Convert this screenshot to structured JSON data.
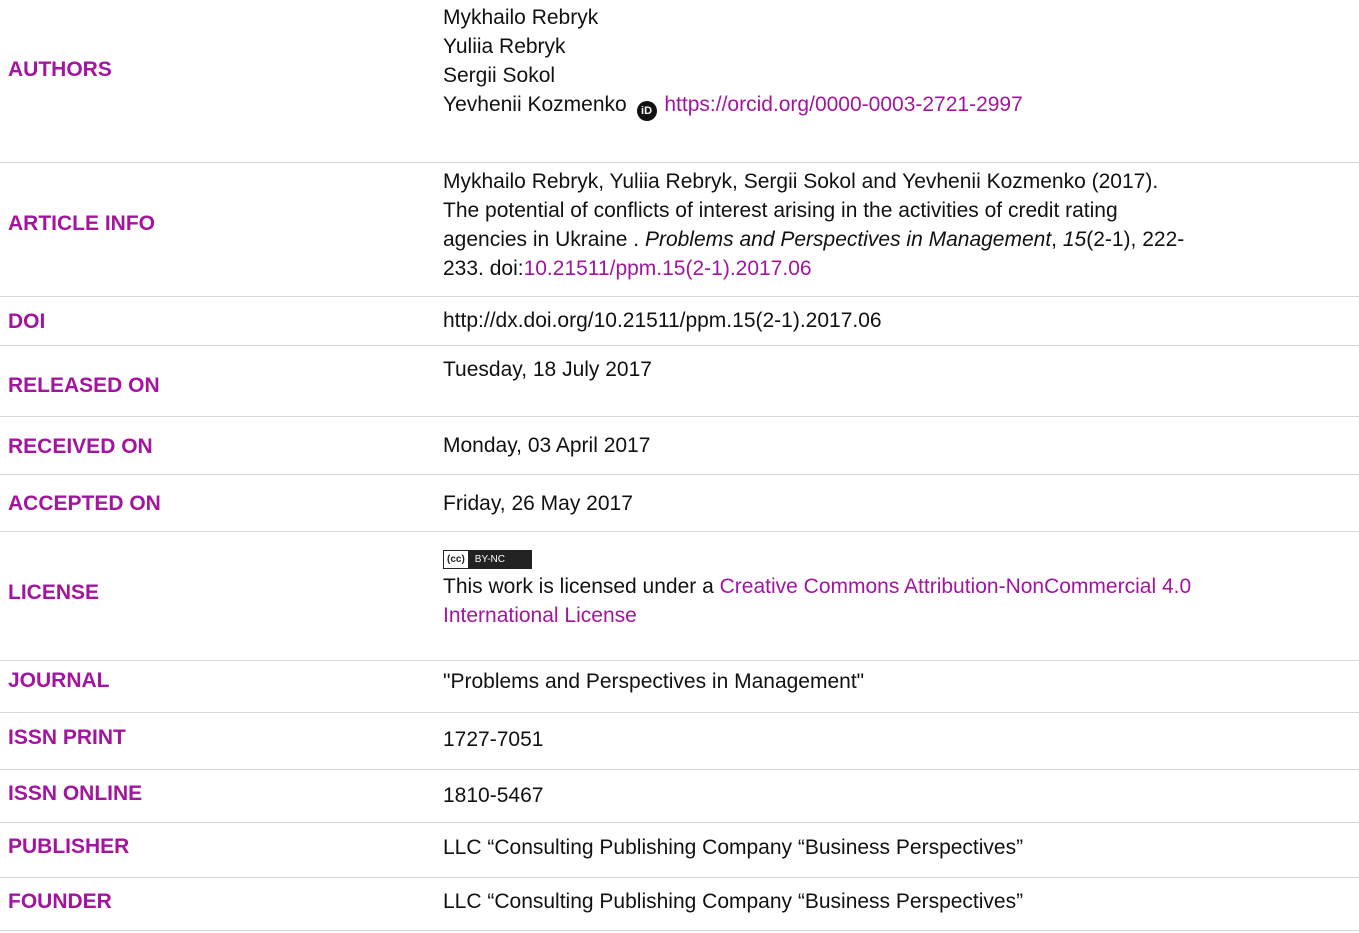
{
  "authors": {
    "label": "AUTHORS",
    "names": [
      "Mykhailo Rebryk",
      "Yuliia Rebryk",
      "Sergii Sokol",
      "Yevhenii Kozmenko"
    ],
    "orcid_icon_text": "iD",
    "orcid_url": "https://orcid.org/0000-0003-2721-2997"
  },
  "article_info": {
    "label": "ARTICLE INFO",
    "line1": "Mykhailo Rebryk, Yuliia Rebryk, Sergii Sokol and Yevhenii Kozmenko (2017).",
    "line2": "The potential of conflicts of interest arising in the activities of credit rating",
    "line3_a": "agencies in Ukraine . ",
    "line3_journal": "Problems and Perspectives in Management",
    "line3_b": ", ",
    "line3_volume": "15",
    "line3_c": "(2-1), 222-",
    "line4_a": "233. doi:",
    "line4_doi": "10.21511/ppm.15(2-1).2017.06"
  },
  "doi": {
    "label": "DOI",
    "value": "http://dx.doi.org/10.21511/ppm.15(2-1).2017.06"
  },
  "released": {
    "label": "RELEASED ON",
    "value": "Tuesday, 18 July 2017"
  },
  "received": {
    "label": "RECEIVED ON",
    "value": "Monday, 03 April 2017"
  },
  "accepted": {
    "label": "ACCEPTED ON",
    "value": "Friday, 26 May 2017"
  },
  "license": {
    "label": "LICENSE",
    "badge_left": "(cc)",
    "badge_right": "BY-NC",
    "text": "This work is licensed under a ",
    "link_line1": "Creative Commons Attribution-NonCommercial 4.0",
    "link_line2": "International License"
  },
  "journal": {
    "label": "JOURNAL",
    "value": "\"Problems and Perspectives in Management\""
  },
  "issn_print": {
    "label": "ISSN PRINT",
    "value": "1727-7051"
  },
  "issn_online": {
    "label": "ISSN ONLINE",
    "value": "1810-5467"
  },
  "publisher": {
    "label": "PUBLISHER",
    "value": "LLC “Consulting Publishing Company “Business Perspectives”"
  },
  "founder": {
    "label": "FOUNDER",
    "value": "LLC “Consulting Publishing Company “Business Perspectives”"
  },
  "colors": {
    "label": "#a3159e",
    "text": "#111111",
    "divider": "#d6d6d6"
  }
}
